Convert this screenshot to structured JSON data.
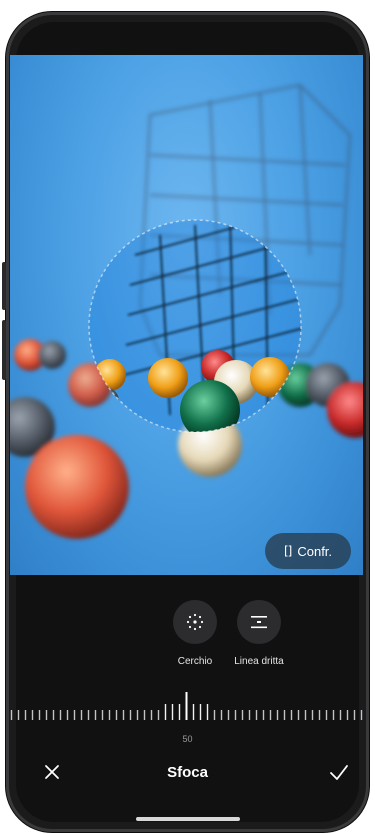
{
  "photo": {
    "compare_label": "Confr.",
    "compare_icon": "compare-icon"
  },
  "tools": {
    "circle": {
      "label": "Cerchio",
      "icon": "circle-blur-icon"
    },
    "line": {
      "label": "Linea dritta",
      "icon": "linear-blur-icon"
    }
  },
  "slider": {
    "value": "50",
    "level": 0.5
  },
  "footer": {
    "title": "Sfoca",
    "cancel_icon": "close-icon",
    "confirm_icon": "check-icon"
  },
  "colors": {
    "background": "#111112",
    "sky": "#4fa3e6",
    "text": "#ffffff",
    "muted": "#9a9a9a"
  }
}
